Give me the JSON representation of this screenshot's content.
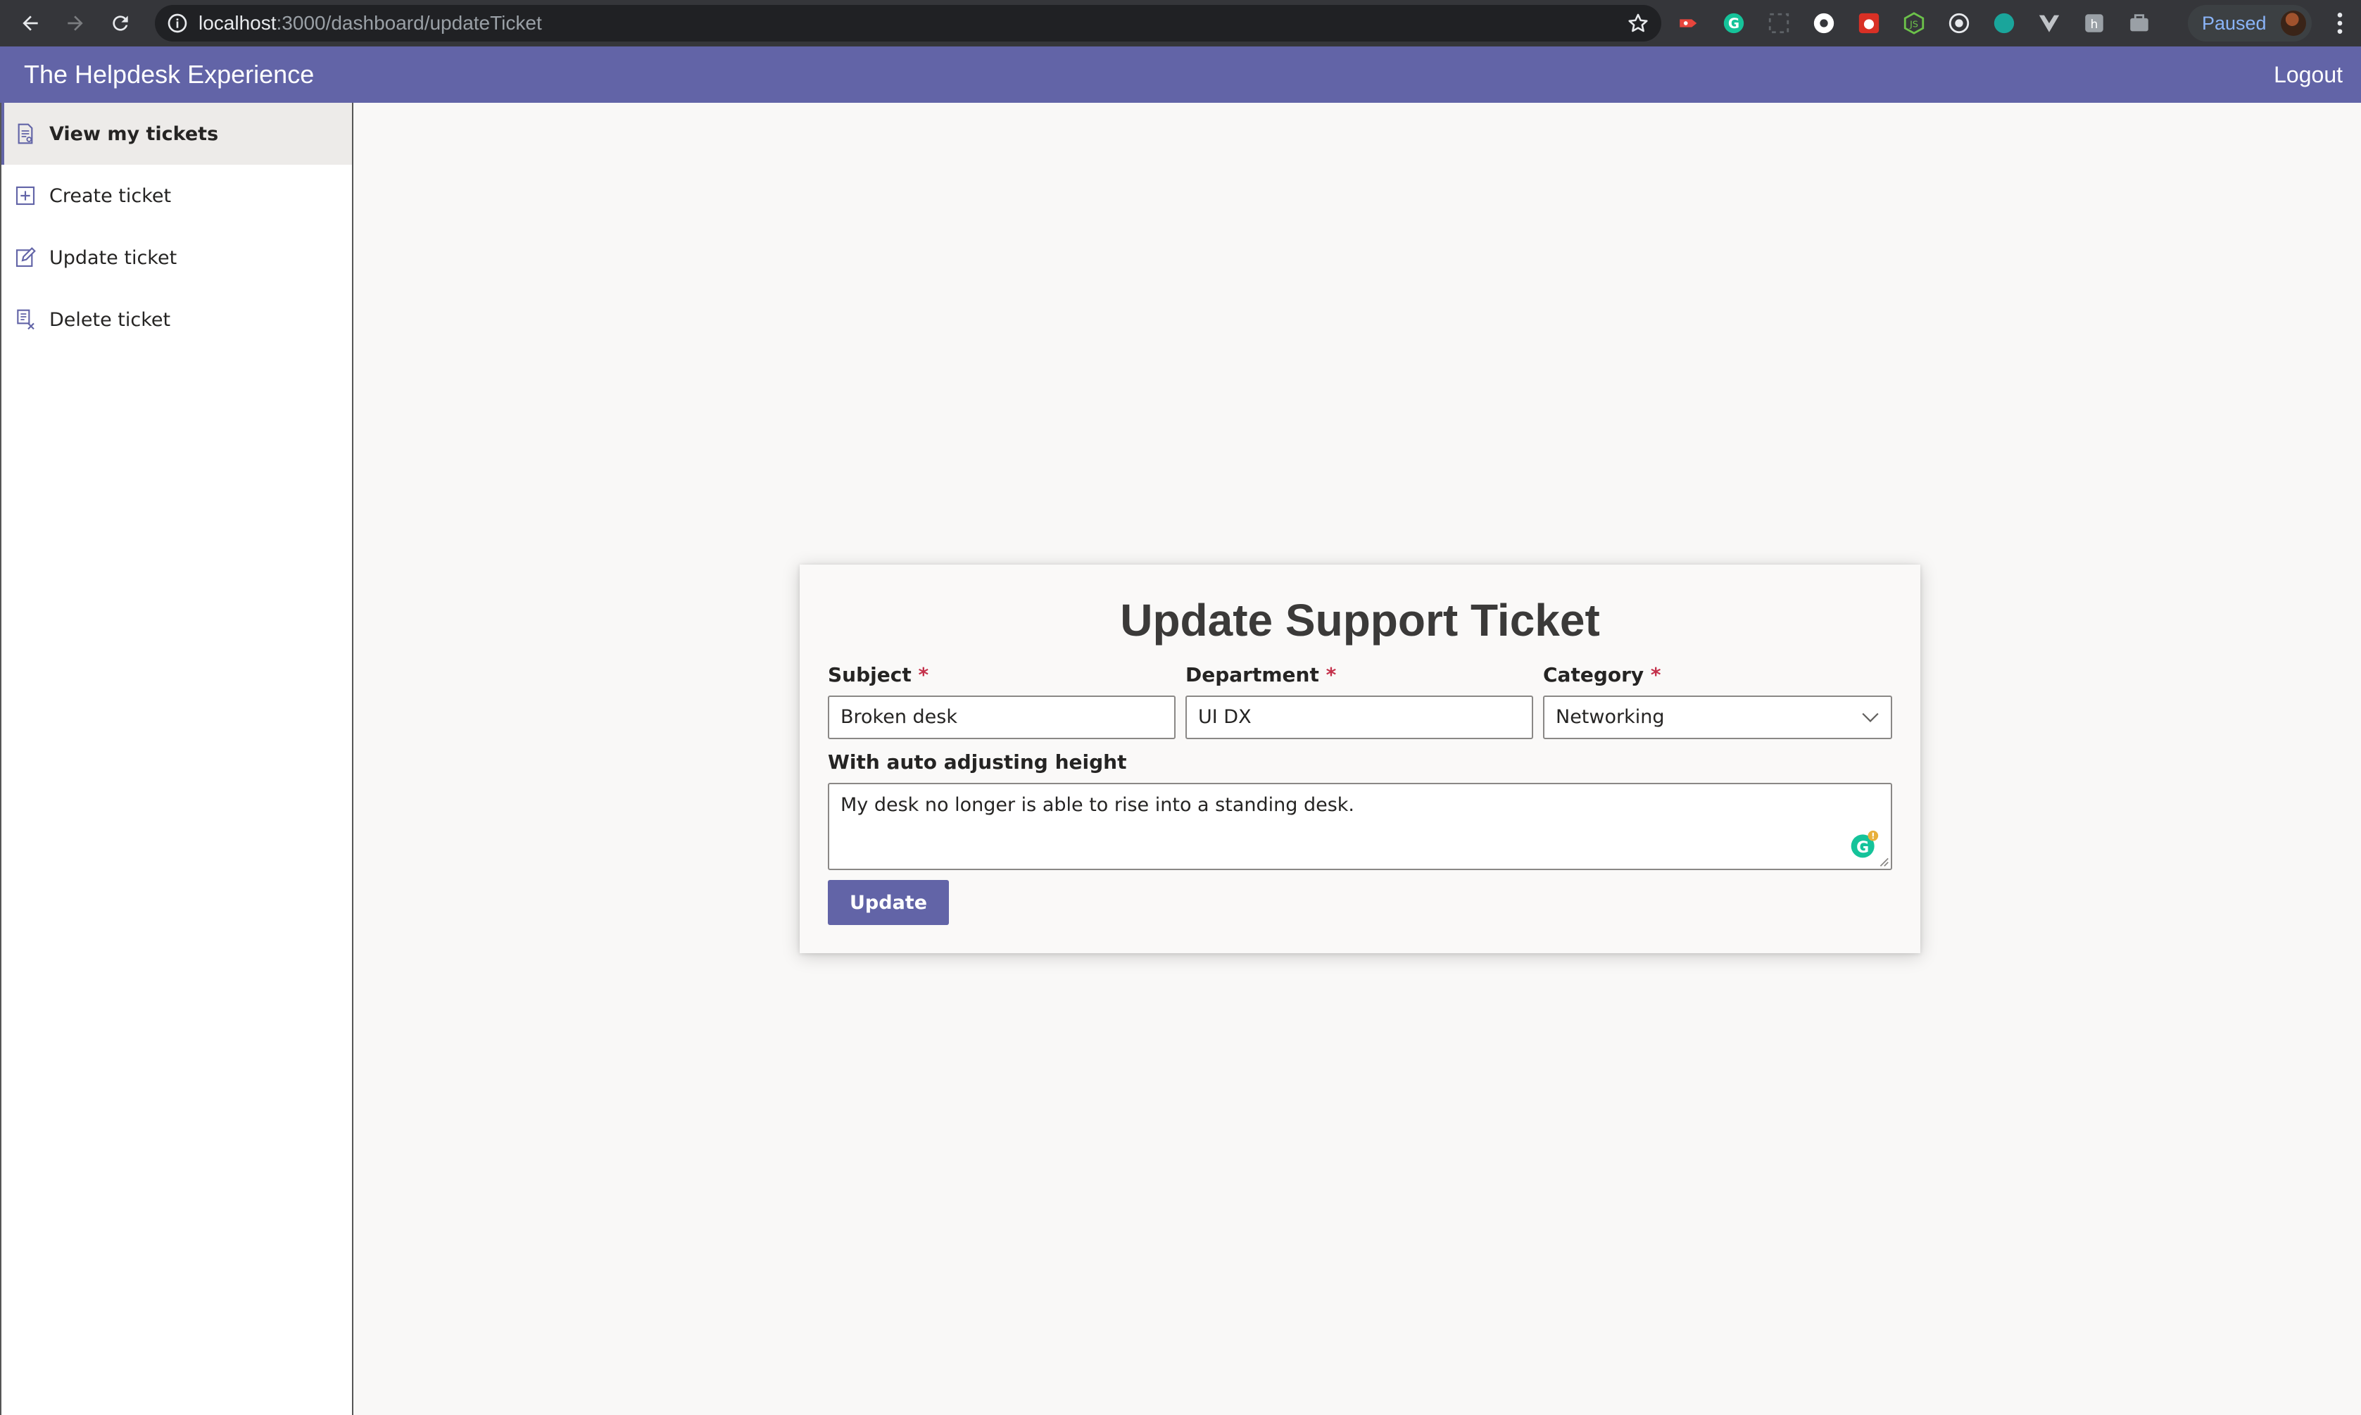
{
  "browser": {
    "url_host": "localhost",
    "url_path": ":3000/dashboard/updateTicket",
    "profile_status": "Paused",
    "icons": [
      "back-icon",
      "forward-icon",
      "reload-icon",
      "info-icon",
      "bookmark-star-icon",
      "chrome-menu-icon"
    ],
    "extensions": [
      "ext-red-icon",
      "grammarly-icon",
      "ext-dashed-icon",
      "ext-white-circle-icon",
      "ext-red-square-icon",
      "nodejs-icon",
      "ext-target-icon",
      "ext-teal-icon",
      "vue-icon",
      "ext-shield-icon",
      "ext-briefcase-icon"
    ]
  },
  "header": {
    "title": "The Helpdesk Experience",
    "logout_label": "Logout",
    "bg_color": "#6264a7"
  },
  "sidebar": {
    "items": [
      {
        "label": "View my tickets",
        "icon": "view-tickets-icon",
        "active": true
      },
      {
        "label": "Create ticket",
        "icon": "create-ticket-icon",
        "active": false
      },
      {
        "label": "Update ticket",
        "icon": "edit-ticket-icon",
        "active": false
      },
      {
        "label": "Delete ticket",
        "icon": "delete-ticket-icon",
        "active": false
      }
    ]
  },
  "form": {
    "title": "Update Support Ticket",
    "subject": {
      "label": "Subject",
      "required_mark": "*",
      "value": "Broken desk"
    },
    "department": {
      "label": "Department",
      "required_mark": "*",
      "value": "UI DX"
    },
    "category": {
      "label": "Category",
      "required_mark": "*",
      "selected": "Networking"
    },
    "description": {
      "label": "With auto adjusting height",
      "value": "My desk no longer is able to rise into a standing desk."
    },
    "submit_label": "Update",
    "accent_color": "#6264a7",
    "required_color": "#c4314b"
  }
}
